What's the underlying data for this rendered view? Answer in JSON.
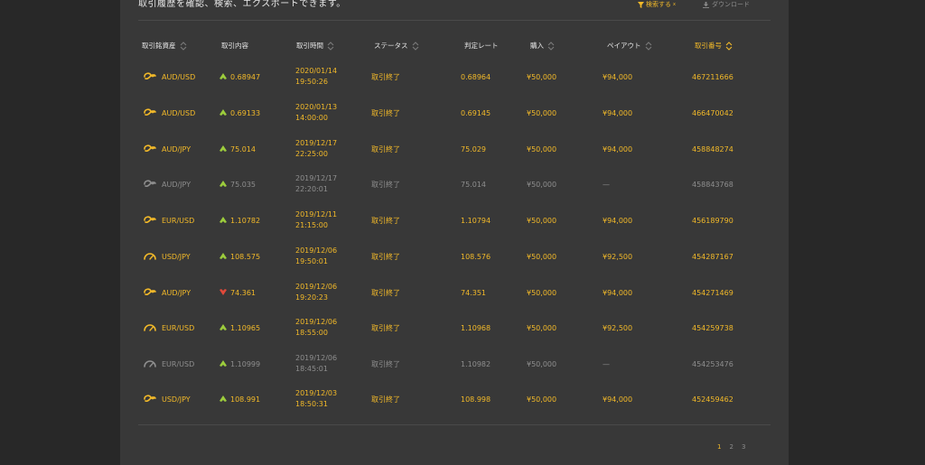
{
  "top": {
    "description": "取引履歴を確認、検索、エクスポートできます。",
    "search_label": "検索する",
    "download_label": "ダウンロード"
  },
  "columns": [
    {
      "key": "asset",
      "label": "取引銘資産",
      "active": false
    },
    {
      "key": "direction",
      "label": "取引内容",
      "active": false
    },
    {
      "key": "time",
      "label": "取引時間",
      "active": false
    },
    {
      "key": "status",
      "label": "ステータス",
      "active": false
    },
    {
      "key": "rate",
      "label": "判定レート",
      "active": false
    },
    {
      "key": "purchase",
      "label": "購入",
      "active": false
    },
    {
      "key": "payout",
      "label": "ペイアウト",
      "active": false
    },
    {
      "key": "trade_id",
      "label": "取引番号",
      "active": true
    }
  ],
  "rows": [
    {
      "icon": "link-icon",
      "asset": "AUD/USD",
      "direction": "up",
      "entry": "0.68947",
      "date": "2020/01/14",
      "time": "19:50:26",
      "status": "取引終了",
      "rate": "0.68964",
      "purchase": "¥50,000",
      "payout": "¥94,000",
      "trade_id": "467211666",
      "active": true
    },
    {
      "icon": "link-icon",
      "asset": "AUD/USD",
      "direction": "up",
      "entry": "0.69133",
      "date": "2020/01/13",
      "time": "14:00:00",
      "status": "取引終了",
      "rate": "0.69145",
      "purchase": "¥50,000",
      "payout": "¥94,000",
      "trade_id": "466470042",
      "active": true
    },
    {
      "icon": "link-icon",
      "asset": "AUD/JPY",
      "direction": "up",
      "entry": "75.014",
      "date": "2019/12/17",
      "time": "22:25:00",
      "status": "取引終了",
      "rate": "75.029",
      "purchase": "¥50,000",
      "payout": "¥94,000",
      "trade_id": "458848274",
      "active": true
    },
    {
      "icon": "link-icon",
      "asset": "AUD/JPY",
      "direction": "up",
      "entry": "75.035",
      "date": "2019/12/17",
      "time": "22:20:01",
      "status": "取引終了",
      "rate": "75.014",
      "purchase": "¥50,000",
      "payout": "—",
      "trade_id": "458843768",
      "active": false
    },
    {
      "icon": "link-icon",
      "asset": "EUR/USD",
      "direction": "up",
      "entry": "1.10782",
      "date": "2019/12/11",
      "time": "21:15:00",
      "status": "取引終了",
      "rate": "1.10794",
      "purchase": "¥50,000",
      "payout": "¥94,000",
      "trade_id": "456189790",
      "active": true
    },
    {
      "icon": "gauge-icon",
      "asset": "USD/JPY",
      "direction": "up",
      "entry": "108.575",
      "date": "2019/12/06",
      "time": "19:50:01",
      "status": "取引終了",
      "rate": "108.576",
      "purchase": "¥50,000",
      "payout": "¥92,500",
      "trade_id": "454287167",
      "active": true
    },
    {
      "icon": "link-icon",
      "asset": "AUD/JPY",
      "direction": "down",
      "entry": "74.361",
      "date": "2019/12/06",
      "time": "19:20:23",
      "status": "取引終了",
      "rate": "74.351",
      "purchase": "¥50,000",
      "payout": "¥94,000",
      "trade_id": "454271469",
      "active": true
    },
    {
      "icon": "gauge-icon",
      "asset": "EUR/USD",
      "direction": "up",
      "entry": "1.10965",
      "date": "2019/12/06",
      "time": "18:55:00",
      "status": "取引終了",
      "rate": "1.10968",
      "purchase": "¥50,000",
      "payout": "¥92,500",
      "trade_id": "454259738",
      "active": true
    },
    {
      "icon": "gauge-icon",
      "asset": "EUR/USD",
      "direction": "up",
      "entry": "1.10999",
      "date": "2019/12/06",
      "time": "18:45:01",
      "status": "取引終了",
      "rate": "1.10982",
      "purchase": "¥50,000",
      "payout": "—",
      "trade_id": "454253476",
      "active": false
    },
    {
      "icon": "link-icon",
      "asset": "USD/JPY",
      "direction": "up",
      "entry": "108.991",
      "date": "2019/12/03",
      "time": "18:50:31",
      "status": "取引終了",
      "rate": "108.998",
      "purchase": "¥50,000",
      "payout": "¥94,000",
      "trade_id": "452459462",
      "active": true
    }
  ],
  "pagination": {
    "pages": [
      "1",
      "2",
      "3"
    ],
    "current": "1"
  },
  "colors": {
    "accent": "#f2b929",
    "inactive": "#8e8e8e",
    "up": "#9ccc3c",
    "down": "#e0493a",
    "panel": "#383838",
    "background": "#282828"
  }
}
